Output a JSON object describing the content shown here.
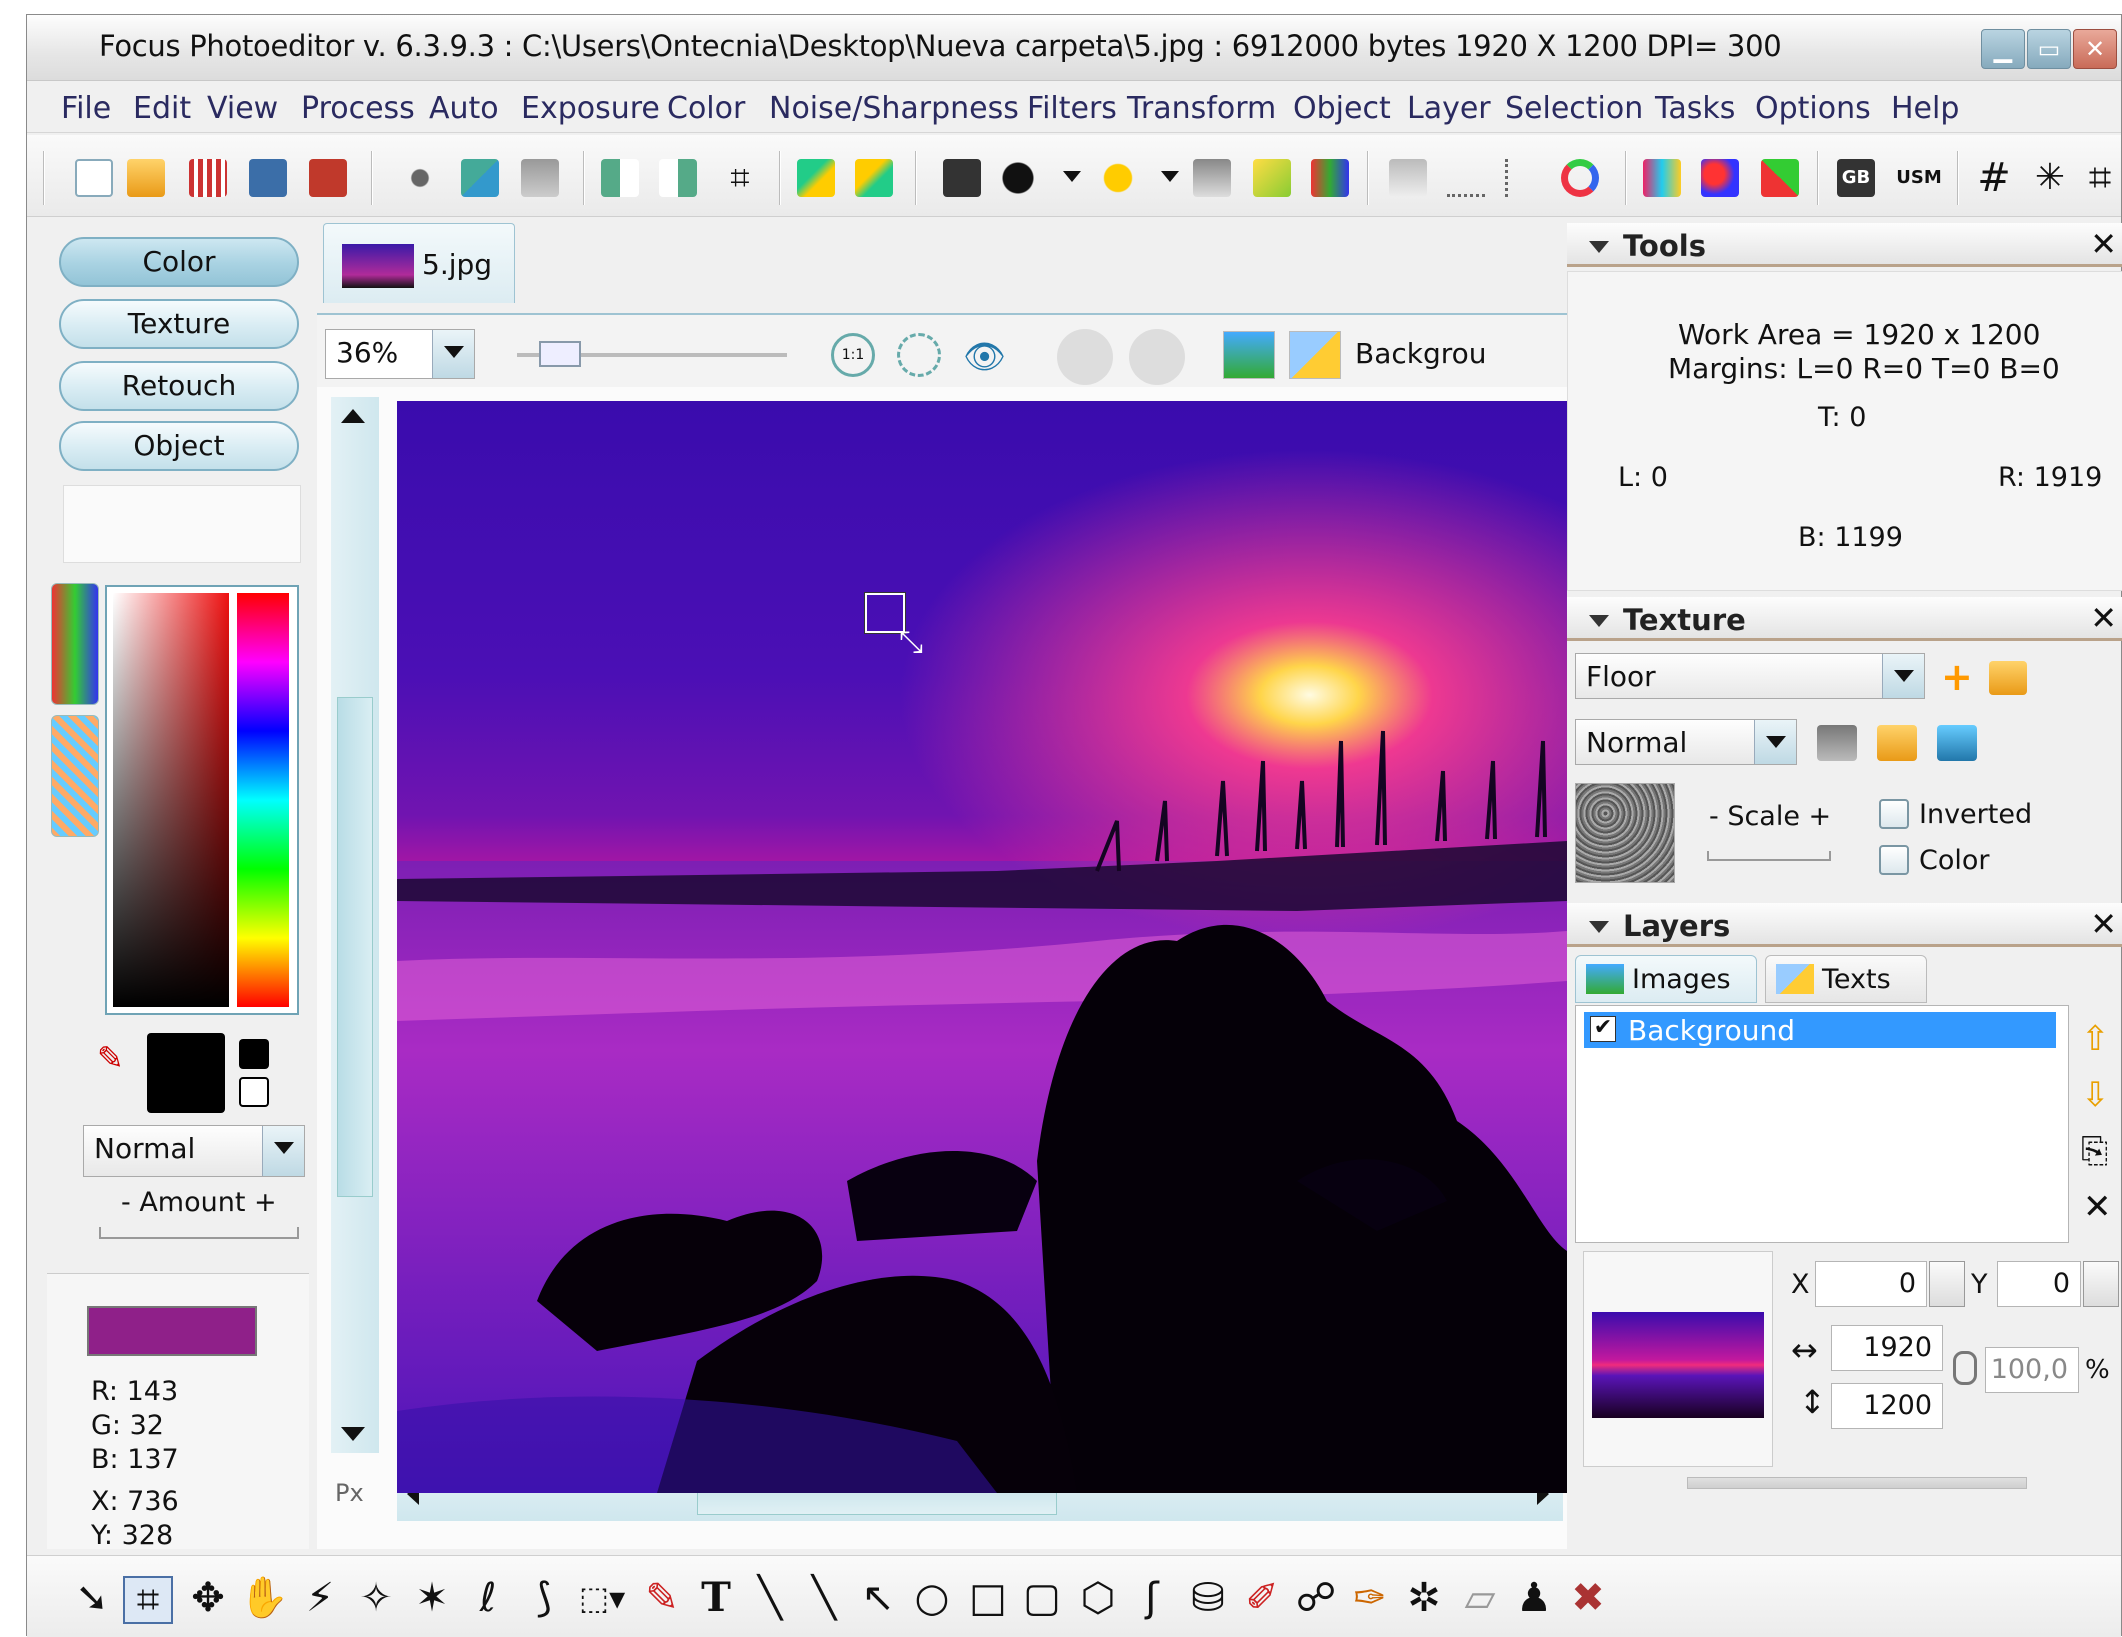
{
  "window": {
    "title": "Focus Photoeditor v. 6.3.9.3 :  C:\\Users\\Ontecnia\\Desktop\\Nueva carpeta\\5.jpg : 6912000 bytes    1920 X 1200 DPI= 300",
    "controls": [
      "minimize",
      "maximize",
      "close"
    ]
  },
  "menu": [
    "File",
    "Edit",
    "View",
    "Process",
    "Auto",
    "Exposure",
    "Color",
    "Noise/Sharpness",
    "Filters",
    "Transform",
    "Object",
    "Layer",
    "Selection",
    "Tasks",
    "Options",
    "Help"
  ],
  "toolbar_icons": [
    "new-file-icon",
    "open-icon",
    "grid-icon",
    "save-icon",
    "save-as-icon",
    "cut-icon",
    "copy-icon",
    "paste-icon",
    "flip-horizontal-icon",
    "flip-vertical-icon",
    "crop-icon",
    "undo-icon",
    "redo-icon",
    "histogram-icon",
    "levels-icon",
    "auto-enhance-icon",
    "noise-icon",
    "white-balance-icon",
    "color-swatch-icon",
    "clone-icon",
    "pen-icon",
    "curve-icon",
    "color-wheel-icon",
    "hue-icon",
    "colorize-icon",
    "replace-color-icon",
    "brightness-icon",
    "usm-icon",
    "grid-hash-icon",
    "sparkle-icon",
    "resize-icon"
  ],
  "toolbar_text": {
    "gb": "GB",
    "usm": "USM"
  },
  "left_panel": {
    "tabs": [
      "Color",
      "Texture",
      "Retouch",
      "Object"
    ],
    "blend_mode": "Normal",
    "amount_label": "- Amount +",
    "selected_color": "#8F2089",
    "readout": {
      "r": "R: 143",
      "g": "G: 32",
      "b": "B: 137",
      "x": "X: 736",
      "y": "Y: 328"
    }
  },
  "document": {
    "tab_name": "5.jpg",
    "zoom": "36%",
    "zoom_1to1": "1:1",
    "layer_name_field": "Backgrou",
    "units": "Px"
  },
  "tools_panel": {
    "title": "Tools",
    "work_area": "Work Area = 1920 x 1200",
    "margins": "Margins: L=0 R=0 T=0 B=0",
    "top": "T: 0",
    "left": "L: 0",
    "right": "R: 1919",
    "bottom": "B: 1199"
  },
  "texture_panel": {
    "title": "Texture",
    "texture": "Floor",
    "mode": "Normal",
    "scale_label": "- Scale +",
    "inverted_label": "Inverted",
    "color_label": "Color"
  },
  "layers_panel": {
    "title": "Layers",
    "tabs": [
      "Images",
      "Texts"
    ],
    "layers": [
      {
        "name": "Background",
        "checked": true
      }
    ],
    "x_label": "X",
    "x": "0",
    "y_label": "Y",
    "y": "0",
    "width": "1920",
    "height": "1200",
    "scale_percent": "100,0",
    "percent_sign": "%"
  },
  "bottom_tools": [
    "pointer-icon",
    "crop-tool-icon",
    "move-icon",
    "hand-icon",
    "magic-wand-icon",
    "lasso-wand-icon",
    "smart-select-icon",
    "lasso-icon",
    "freehand-select-icon",
    "rect-select-icon",
    "eyedropper-icon",
    "text-tool-icon",
    "brush-icon",
    "line-icon",
    "arrow-icon",
    "ellipse-icon",
    "rectangle-icon",
    "rounded-rect-icon",
    "polygon-icon",
    "curve-tool-icon",
    "fill-icon",
    "color-replace-icon",
    "smudge-icon",
    "paint-icon",
    "clone-tool-icon",
    "eraser-icon",
    "stamp-icon",
    "heal-icon"
  ],
  "bottom_text": {
    "text_tool": "T"
  }
}
